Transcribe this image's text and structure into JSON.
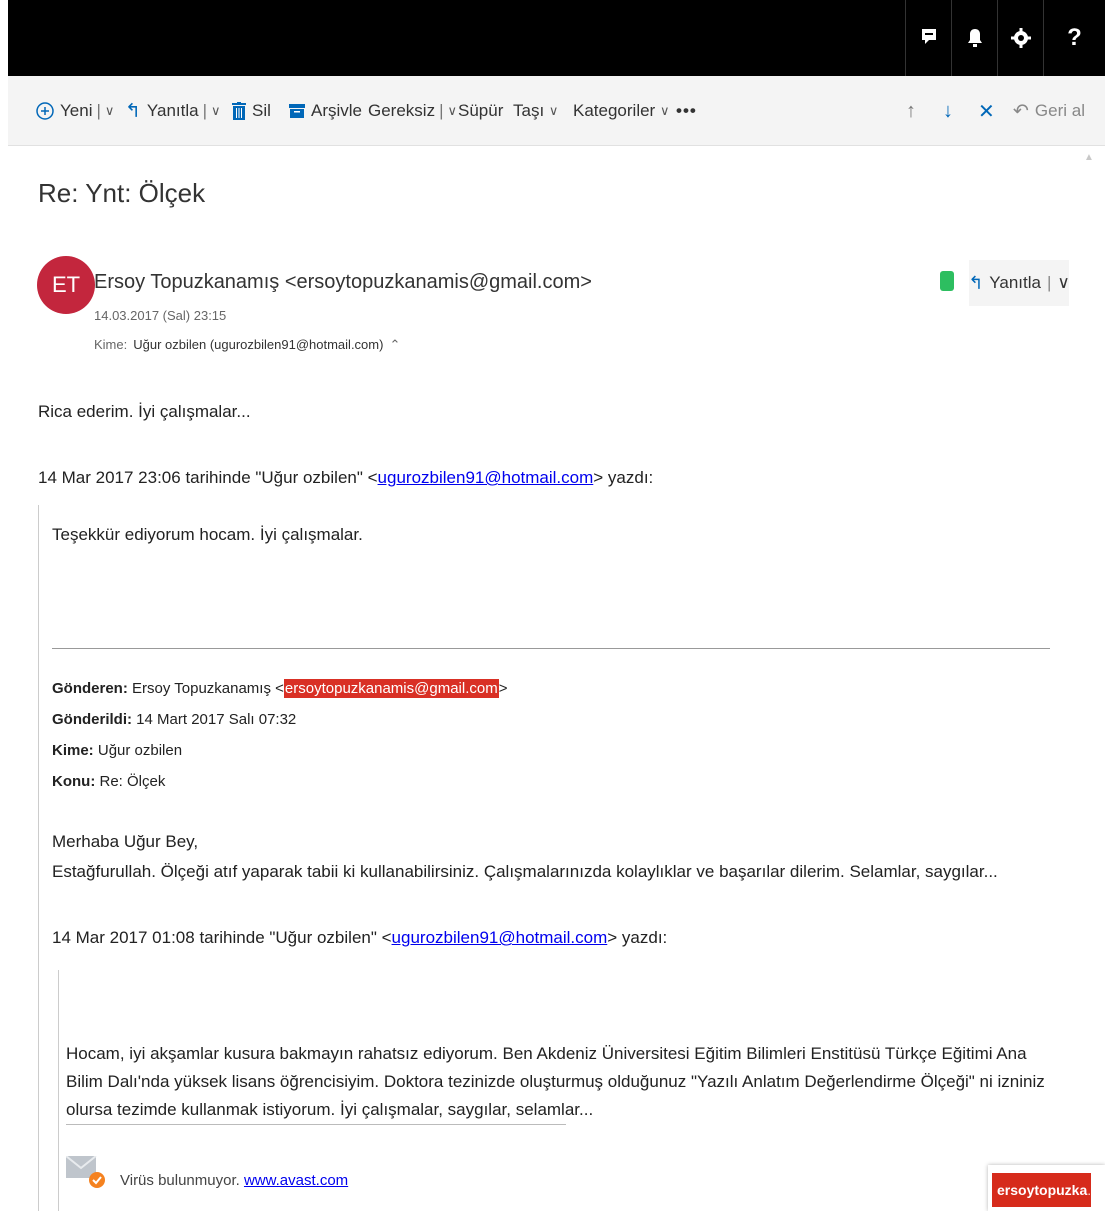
{
  "topbar": {
    "icons": [
      "chat-icon",
      "bell-icon",
      "gear-icon",
      "help-icon"
    ],
    "help_label": "?"
  },
  "toolbar": {
    "new_label": "Yeni",
    "reply_label": "Yanıtla",
    "delete_label": "Sil",
    "archive_label": "Arşivle",
    "junk_label": "Gereksiz",
    "sweep_label": "Süpür",
    "move_label": "Taşı",
    "categories_label": "Kategoriler",
    "more_label": "•••",
    "undo_label": "Geri al"
  },
  "message": {
    "subject": "Re: Ynt: Ölçek",
    "avatar_initials": "ET",
    "avatar_color": "#c3263d",
    "sender": "Ersoy Topuzkanamış <ersoytopuzkanamis@gmail.com>",
    "date": "14.03.2017 (Sal) 23:15",
    "to_label": "Kime:",
    "to_value": "Uğur ozbilen (ugurozbilen91@hotmail.com)",
    "reply_button": "Yanıtla"
  },
  "body": {
    "thanks": "Rica ederim. İyi çalışmalar...",
    "quote1_intro_pre": "14 Mar 2017 23:06 tarihinde \"Uğur ozbilen\" <",
    "quote1_email": "ugurozbilen91@hotmail.com",
    "quote1_intro_post": "> yazdı:",
    "quote1_text": "Teşekkür ediyorum hocam. İyi çalışmalar.",
    "from_label": "Gönderen:",
    "from_name": "Ersoy Topuzkanamış <",
    "from_email": "ersoytopuzkanamis@gmail.com",
    "from_close": ">",
    "sent_label": "Gönderildi:",
    "sent_value": "14 Mart 2017 Salı 07:32",
    "to_label": "Kime:",
    "to_value": "Uğur ozbilen",
    "subject_label": "Konu:",
    "subject_value": "Re: Ölçek",
    "greeting": "Merhaba Uğur Bey,",
    "message": "Estağfurullah. Ölçeği atıf yaparak tabii ki kullanabilirsiniz. Çalışmalarınızda kolaylıklar ve başarılar dilerim. Selamlar, saygılar...",
    "quote2_intro_pre": "14 Mar 2017 01:08 tarihinde \"Uğur ozbilen\" <",
    "quote2_email": "ugurozbilen91@hotmail.com",
    "quote2_intro_post": "> yazdı:",
    "original_text": "Hocam, iyi akşamlar kusura bakmayın rahatsız ediyorum. Ben Akdeniz Üniversitesi Eğitim Bilimleri Enstitüsü Türkçe Eğitimi Ana Bilim Dalı'nda yüksek lisans öğrencisiyim.  Doktora tezinizde oluşturmuş olduğunuz \"Yazılı Anlatım Değerlendirme Ölçeği\" ni izniniz olursa tezimde kullanmak istiyorum. İyi çalışmalar, saygılar, selamlar...",
    "virus_text": "Virüs bulunmuyor.",
    "avast_link": "www.avast.com"
  },
  "tag": {
    "label": "ersoytopuzka",
    "ellipsis": "..."
  }
}
